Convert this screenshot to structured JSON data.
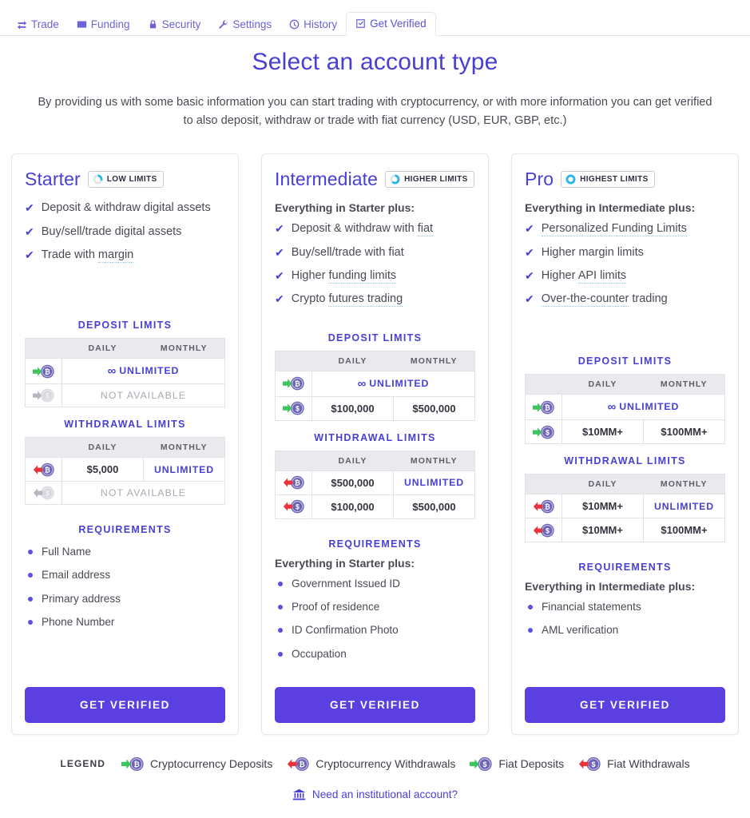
{
  "nav": {
    "tabs": [
      {
        "label": "Trade",
        "icon": "exchange-icon",
        "active": false
      },
      {
        "label": "Funding",
        "icon": "money-icon",
        "active": false
      },
      {
        "label": "Security",
        "icon": "lock-icon",
        "active": false
      },
      {
        "label": "Settings",
        "icon": "wrench-icon",
        "active": false
      },
      {
        "label": "History",
        "icon": "clock-icon",
        "active": false
      },
      {
        "label": "Get Verified",
        "icon": "check-square-icon",
        "active": true
      }
    ]
  },
  "hero": {
    "title": "Select an account type",
    "subtitle": "By providing us with some basic information you can start trading with cryptocurrency, or with more information you can get verified to also deposit, withdraw or trade with fiat currency (USD, EUR, GBP, etc.)"
  },
  "labels": {
    "deposit_limits": "DEPOSIT LIMITS",
    "withdrawal_limits": "WITHDRAWAL LIMITS",
    "requirements": "REQUIREMENTS",
    "col_daily": "DAILY",
    "col_monthly": "MONTHLY",
    "cta": "GET VERIFIED",
    "unlimited": "UNLIMITED",
    "not_available": "NOT AVAILABLE",
    "infinity": "∞"
  },
  "colors": {
    "brand_purple": "#4840d4",
    "cta_purple": "#5b3fe0",
    "cyan": "#29b6e8",
    "crypto_coin": "#6b63b5",
    "fiat_coin": "#b9b9c8",
    "deposit_arrow": "#3ec45c",
    "withdraw_arrow": "#e8343a",
    "text_gray": "#4a4a55",
    "header_gray": "#e9e9ee",
    "disabled_gray": "#a9a9b4"
  },
  "cards": [
    {
      "tier": "Starter",
      "badge": "LOW LIMITS",
      "badge_level": 1,
      "plus_line": null,
      "features": [
        {
          "text": "Deposit & withdraw digital assets",
          "dotted": null
        },
        {
          "text": "Buy/sell/trade digital assets",
          "dotted": null
        },
        {
          "text": "Trade with margin",
          "dotted": "margin"
        }
      ],
      "deposit": {
        "rows": [
          {
            "icon": "crypto-deposit-icon",
            "span": true,
            "daily": "UNLIMITED",
            "monthly": null,
            "style": "unlimited"
          },
          {
            "icon": "fiat-deposit-disabled-icon",
            "span": true,
            "daily": "NOT AVAILABLE",
            "monthly": null,
            "style": "na"
          }
        ]
      },
      "withdrawal": {
        "rows": [
          {
            "icon": "crypto-withdraw-icon",
            "span": false,
            "daily": "$5,000",
            "monthly": "UNLIMITED",
            "style": "mixed"
          },
          {
            "icon": "fiat-withdraw-disabled-icon",
            "span": true,
            "daily": "NOT AVAILABLE",
            "monthly": null,
            "style": "na"
          }
        ]
      },
      "req_plus_line": null,
      "requirements": [
        "Full Name",
        "Email address",
        "Primary address",
        "Phone Number"
      ],
      "cta": "GET VERIFIED"
    },
    {
      "tier": "Intermediate",
      "badge": "HIGHER LIMITS",
      "badge_level": 2,
      "plus_line": "Everything in Starter plus:",
      "features": [
        {
          "text": "Deposit & withdraw with fiat",
          "dotted": "fiat"
        },
        {
          "text": "Buy/sell/trade with fiat",
          "dotted": null
        },
        {
          "text": "Higher funding limits",
          "dotted": "funding limits"
        },
        {
          "text": "Crypto futures trading",
          "dotted": "futures trading"
        }
      ],
      "deposit": {
        "rows": [
          {
            "icon": "crypto-deposit-icon",
            "span": true,
            "daily": "UNLIMITED",
            "monthly": null,
            "style": "unlimited"
          },
          {
            "icon": "fiat-deposit-icon",
            "span": false,
            "daily": "$100,000",
            "monthly": "$500,000",
            "style": "amt"
          }
        ]
      },
      "withdrawal": {
        "rows": [
          {
            "icon": "crypto-withdraw-icon",
            "span": false,
            "daily": "$500,000",
            "monthly": "UNLIMITED",
            "style": "mixed"
          },
          {
            "icon": "fiat-withdraw-icon",
            "span": false,
            "daily": "$100,000",
            "monthly": "$500,000",
            "style": "amt"
          }
        ]
      },
      "req_plus_line": "Everything in Starter plus:",
      "requirements": [
        "Government Issued ID",
        "Proof of residence",
        "ID Confirmation Photo",
        "Occupation"
      ],
      "cta": "GET VERIFIED"
    },
    {
      "tier": "Pro",
      "badge": "HIGHEST LIMITS",
      "badge_level": 3,
      "plus_line": "Everything in Intermediate plus:",
      "features": [
        {
          "text": "Personalized Funding Limits",
          "dotted": "Personalized Funding Limits"
        },
        {
          "text": "Higher margin limits",
          "dotted": null
        },
        {
          "text": "Higher API limits",
          "dotted": "API limits"
        },
        {
          "text": "Over-the-counter trading",
          "dotted": "Over-the-counter"
        }
      ],
      "deposit": {
        "rows": [
          {
            "icon": "crypto-deposit-icon",
            "span": true,
            "daily": "UNLIMITED",
            "monthly": null,
            "style": "unlimited"
          },
          {
            "icon": "fiat-deposit-icon",
            "span": false,
            "daily": "$10MM+",
            "monthly": "$100MM+",
            "style": "amt"
          }
        ]
      },
      "withdrawal": {
        "rows": [
          {
            "icon": "crypto-withdraw-icon",
            "span": false,
            "daily": "$10MM+",
            "monthly": "UNLIMITED",
            "style": "mixed"
          },
          {
            "icon": "fiat-withdraw-icon",
            "span": false,
            "daily": "$10MM+",
            "monthly": "$100MM+",
            "style": "amt"
          }
        ]
      },
      "req_plus_line": "Everything in Intermediate plus:",
      "requirements": [
        "Financial statements",
        "AML verification"
      ],
      "cta": "GET VERIFIED"
    }
  ],
  "legend": {
    "title": "LEGEND",
    "items": [
      {
        "label": "Cryptocurrency Deposits",
        "icon": "crypto-deposit-icon"
      },
      {
        "label": "Cryptocurrency Withdrawals",
        "icon": "crypto-withdraw-icon"
      },
      {
        "label": "Fiat Deposits",
        "icon": "fiat-deposit-icon"
      },
      {
        "label": "Fiat Withdrawals",
        "icon": "fiat-withdraw-icon"
      }
    ]
  },
  "institutional": {
    "label": "Need an institutional account?",
    "icon": "bank-icon"
  }
}
